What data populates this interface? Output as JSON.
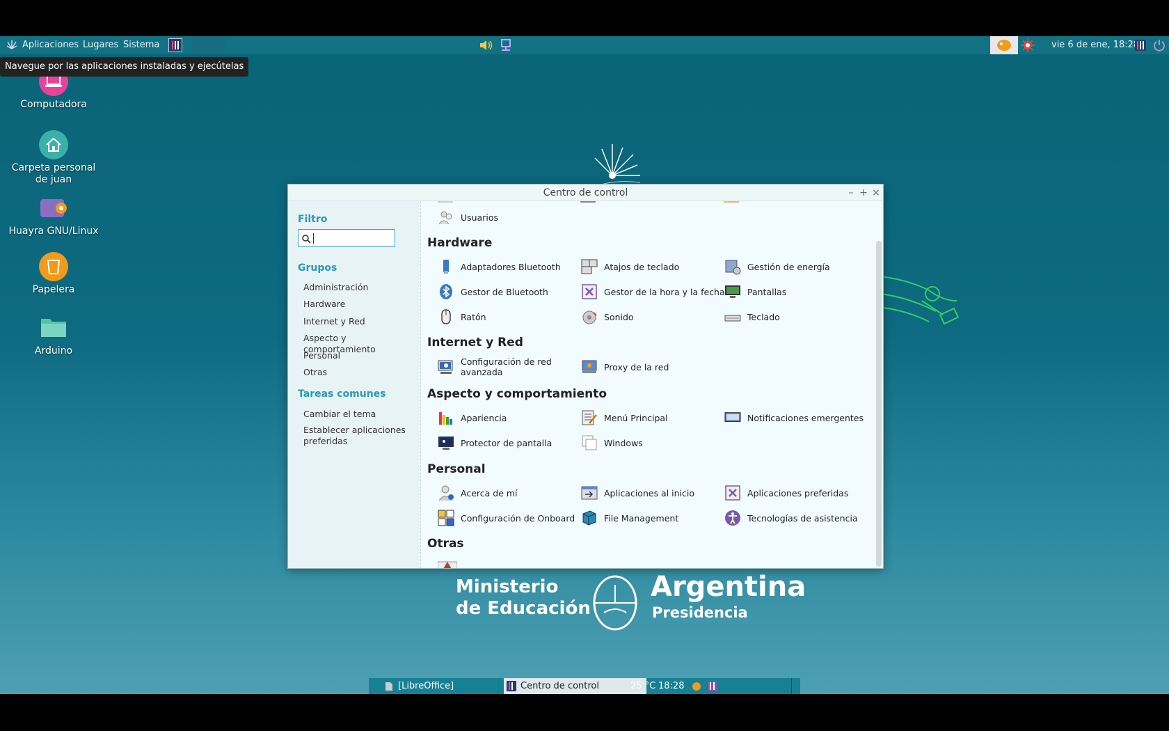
{
  "top_panel": {
    "menus": [
      "Aplicaciones",
      "Lugares",
      "Sistema"
    ],
    "clock": "vie  6 de ene, 18:28"
  },
  "tooltip": "Navegue por las aplicaciones instaladas y ejecútelas",
  "desktop_icons": [
    {
      "label": "Computadora",
      "icon": "laptop-icon",
      "color": "#e8439a"
    },
    {
      "label": "Carpeta personal de juan",
      "icon": "home-icon",
      "color": "#3ab0a8"
    },
    {
      "label": "Huayra GNU/Linux",
      "icon": "drive-icon",
      "color": "#8a6ec2"
    },
    {
      "label": "Papelera",
      "icon": "trash-icon",
      "color": "#f39a1c"
    },
    {
      "label": "Arduino",
      "icon": "folder-icon",
      "color": "#58c2a8"
    }
  ],
  "logo": {
    "line1": "Ministerio",
    "line2": "de Educación",
    "country": "Argentina",
    "sub": "Presidencia"
  },
  "window": {
    "title": "Centro de control",
    "controls": {
      "minimize": "–",
      "maximize": "+",
      "close": "×"
    },
    "sidebar": {
      "filter_label": "Filtro",
      "search_placeholder": "",
      "groups_label": "Grupos",
      "groups": [
        "Administración",
        "Hardware",
        "Internet y Red",
        "Aspecto y comportamiento",
        "Personal",
        "Otras"
      ],
      "tasks_label": "Tareas comunes",
      "tasks": [
        "Cambiar el tema",
        "Establecer aplicaciones preferidas"
      ]
    },
    "content": {
      "admin_items": [
        "Usuarios"
      ],
      "categories": [
        {
          "title": "Hardware",
          "items": [
            {
              "label": "Adaptadores Bluetooth",
              "icon": "bluetooth-adapter-icon"
            },
            {
              "label": "Atajos de teclado",
              "icon": "keyboard-shortcuts-icon"
            },
            {
              "label": "Gestión de energía",
              "icon": "power-management-icon"
            },
            {
              "label": "Gestor de Bluetooth",
              "icon": "bluetooth-icon"
            },
            {
              "label": "Gestor de la hora y la fecha",
              "icon": "clock-icon"
            },
            {
              "label": "Pantallas",
              "icon": "display-icon"
            },
            {
              "label": "Ratón",
              "icon": "mouse-icon"
            },
            {
              "label": "Sonido",
              "icon": "sound-icon"
            },
            {
              "label": "Teclado",
              "icon": "keyboard-icon"
            }
          ]
        },
        {
          "title": "Internet y Red",
          "items": [
            {
              "label": "Configuración de red avanzada",
              "icon": "network-config-icon"
            },
            {
              "label": "Proxy de la red",
              "icon": "proxy-icon"
            }
          ]
        },
        {
          "title": "Aspecto y comportamiento",
          "items": [
            {
              "label": "Apariencia",
              "icon": "appearance-icon"
            },
            {
              "label": "Menú Principal",
              "icon": "main-menu-icon"
            },
            {
              "label": "Notificaciones emergentes",
              "icon": "notifications-icon"
            },
            {
              "label": "Protector de pantalla",
              "icon": "screensaver-icon"
            },
            {
              "label": "Windows",
              "icon": "windows-icon"
            }
          ]
        },
        {
          "title": "Personal",
          "items": [
            {
              "label": "Acerca de mí",
              "icon": "about-me-icon"
            },
            {
              "label": "Aplicaciones al inicio",
              "icon": "startup-apps-icon"
            },
            {
              "label": "Aplicaciones preferidas",
              "icon": "preferred-apps-icon"
            },
            {
              "label": "Configuración de Onboard",
              "icon": "onboard-icon"
            },
            {
              "label": "File Management",
              "icon": "file-management-icon"
            },
            {
              "label": "Tecnologías de asistencia",
              "icon": "accessibility-icon"
            }
          ]
        },
        {
          "title": "Otras",
          "items": []
        }
      ]
    }
  },
  "bottom_panel": {
    "tasks": [
      "[LibreOffice]",
      "Centro de control"
    ],
    "temperature": "25 °C",
    "clock": "18:28"
  }
}
